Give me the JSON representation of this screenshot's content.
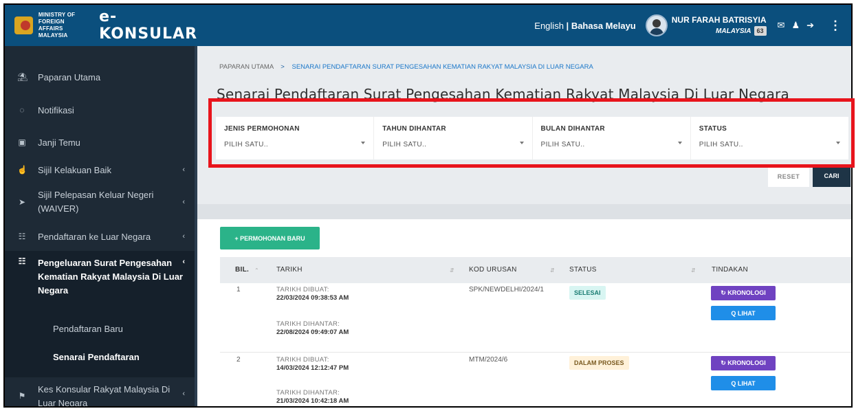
{
  "header": {
    "ministry": "MINISTRY OF FOREIGN AFFAIRS MALAYSIA",
    "logo": "e-KONSULAR",
    "lang_en": "English",
    "lang_sep": "|",
    "lang_ms": "Bahasa Melayu",
    "user_name": "NUR FARAH BATRISYIA",
    "user_country": "MALAYSIA",
    "notification_count": "63"
  },
  "sidebar": {
    "items": [
      {
        "label": "Paparan Utama",
        "icon": "home-icon"
      },
      {
        "label": "Notifikasi",
        "icon": "chat-icon"
      },
      {
        "label": "Janji Temu",
        "icon": "calendar-icon"
      },
      {
        "label": "Sijil Kelakuan Baik",
        "icon": "thumbs-up-icon"
      },
      {
        "label": "Sijil Pelepasan Keluar Negeri",
        "label2": "(WAIVER)",
        "icon": "send-icon"
      },
      {
        "label": "Pendaftaran ke Luar Negara",
        "icon": "map-icon"
      },
      {
        "label": "Pengeluaran Surat Pengesahan",
        "label2": "Kematian Rakyat Malaysia Di Luar",
        "label3": "Negara",
        "icon": "map-icon"
      },
      {
        "label": "Kes Konsular Rakyat Malaysia Di",
        "label2": "Luar Negara",
        "icon": "flag-icon"
      }
    ],
    "sub_items": [
      "Pendaftaran Baru",
      "Senarai Pendaftaran"
    ]
  },
  "breadcrumb": {
    "home": "PAPARAN UTAMA",
    "separator": ">",
    "current": "SENARAI PENDAFTARAN SURAT PENGESAHAN KEMATIAN RAKYAT MALAYSIA DI LUAR NEGARA"
  },
  "page_title": "Senarai Pendaftaran Surat Pengesahan Kematian Rakyat Malaysia Di Luar Negara",
  "filters": [
    {
      "label": "JENIS PERMOHONAN",
      "value": "PILIH SATU.."
    },
    {
      "label": "TAHUN DIHANTAR",
      "value": "PILIH SATU.."
    },
    {
      "label": "BULAN DIHANTAR",
      "value": "PILIH SATU.."
    },
    {
      "label": "STATUS",
      "value": "PILIH SATU.."
    }
  ],
  "buttons": {
    "reset": "RESET",
    "search": "CARI",
    "new_application": "+ PERMOHONAN BARU",
    "kronologi": "↻ KRONOLOGI",
    "lihat": "Q LIHAT"
  },
  "table": {
    "headers": [
      "BIL.",
      "TARIKH",
      "KOD URUSAN",
      "STATUS",
      "TINDAKAN"
    ],
    "created_label": "TARIKH DIBUAT:",
    "submitted_label": "TARIKH DIHANTAR:",
    "rows": [
      {
        "no": "1",
        "created": "22/03/2024 09:38:53 AM",
        "submitted": "22/08/2024 09:49:07 AM",
        "code": "SPK/NEWDELHI/2024/1",
        "status": "SELESAI"
      },
      {
        "no": "2",
        "created": "14/03/2024 12:12:47 PM",
        "submitted": "21/03/2024 10:42:18 AM",
        "code": "MTM/2024/6",
        "status": "DALAM PROSES"
      }
    ]
  }
}
